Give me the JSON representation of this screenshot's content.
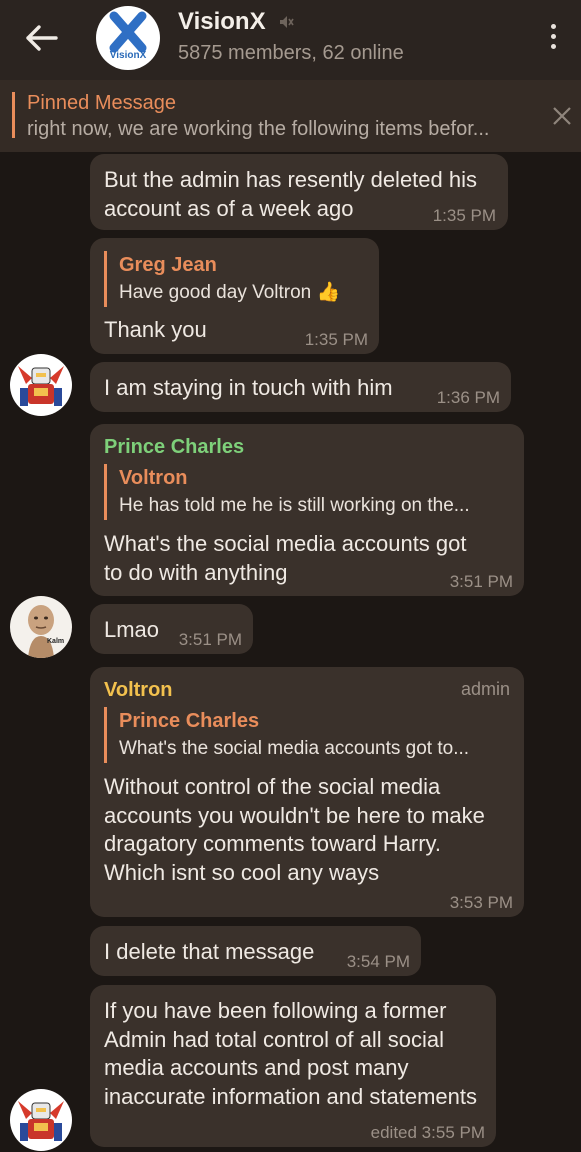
{
  "header": {
    "title": "VisionX",
    "subtitle": "5875 members, 62 online",
    "logo_text": "VisionX"
  },
  "pinned": {
    "label": "Pinned Message",
    "text": "right now, we are working the following items befor..."
  },
  "messages": [
    {
      "text": "But the admin has resently deleted his account as of  a week ago",
      "time": "1:35 PM"
    },
    {
      "reply_name": "Greg Jean",
      "reply_text": "Have good day Voltron 👍",
      "text": "Thank you",
      "time": "1:35 PM"
    },
    {
      "text": "I am staying in touch with him",
      "time": "1:36 PM"
    },
    {
      "sender": "Prince Charles",
      "reply_name": "Voltron",
      "reply_text": "He has told me he is still working on the...",
      "text": "What's the social media accounts got to do with anything",
      "time": "3:51 PM"
    },
    {
      "text": "Lmao",
      "time": "3:51 PM",
      "avatar_label": "Kalm"
    },
    {
      "sender": "Voltron",
      "admin": "admin",
      "reply_name": "Prince Charles",
      "reply_text": "What's the social media accounts got to...",
      "text": "Without control of the social media accounts you wouldn't be here to make dragatory comments toward Harry.  Which isnt so cool any ways",
      "time": "3:53 PM"
    },
    {
      "text": "I delete that message",
      "time": "3:54 PM"
    },
    {
      "text": "If you have been following a former Admin had total control of all social media accounts and  post many inaccurate information and statements",
      "time": "edited 3:55 PM"
    }
  ],
  "colors": {
    "background": "#1c1714",
    "header": "#2b2420",
    "bubble": "#3a312b",
    "reply_accent": "#e98d5b",
    "sender_green": "#7ed07a",
    "sender_yellow": "#f2c14e"
  }
}
